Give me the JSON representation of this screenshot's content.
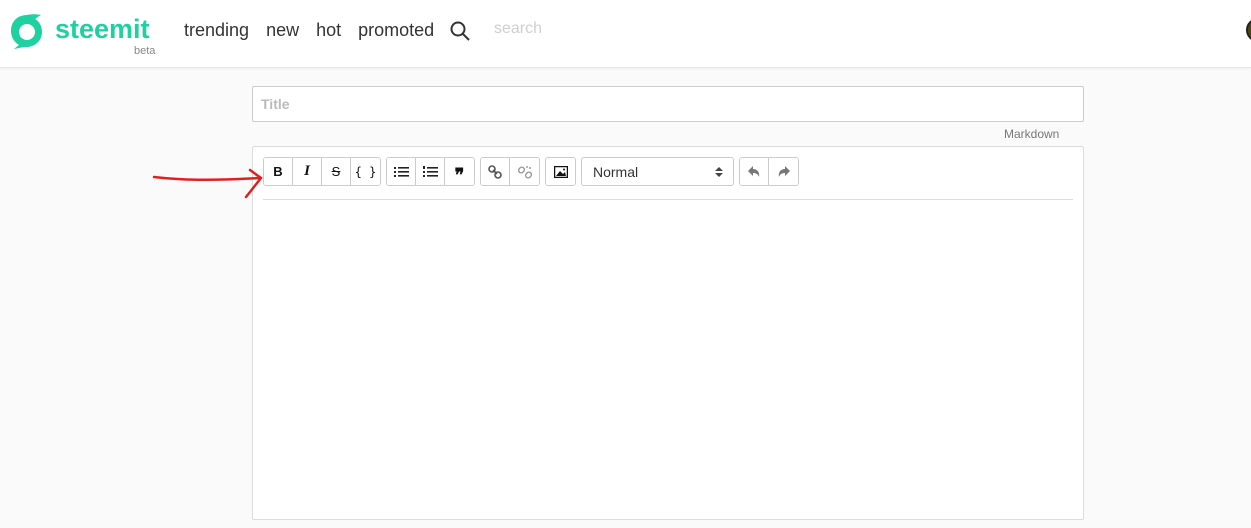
{
  "header": {
    "brand": "steemit",
    "badge": "beta",
    "brand_color": "#1fd0a0",
    "nav": [
      "trending",
      "new",
      "hot",
      "promoted"
    ],
    "search_placeholder": "search"
  },
  "editor": {
    "title_placeholder": "Title",
    "mode_link": "Markdown",
    "toolbar": {
      "bold": "B",
      "italic": "I",
      "strike": "S",
      "code": "{ }",
      "format_select": "Normal"
    }
  },
  "annotation_color": "#e02020"
}
